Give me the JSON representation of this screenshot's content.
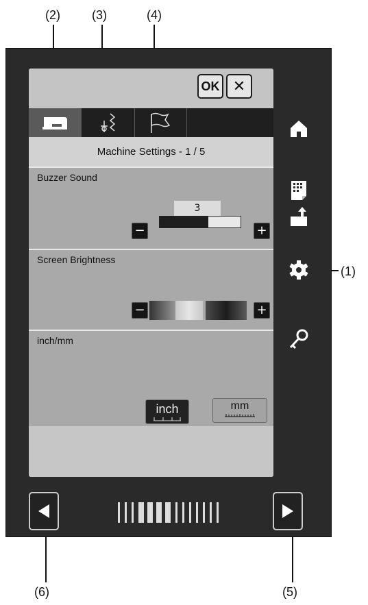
{
  "callouts": {
    "c1": "(1)",
    "c2": "(2)",
    "c3": "(3)",
    "c4": "(4)",
    "c5": "(5)",
    "c6": "(6)"
  },
  "header": {
    "ok_label": "OK",
    "close_symbol": "✕"
  },
  "tabs": [
    {
      "icon": "sewing-machine-icon",
      "active": true
    },
    {
      "icon": "stitch-icon",
      "active": false
    },
    {
      "icon": "flag-icon",
      "active": false
    }
  ],
  "page_title": "Machine Settings  -  1 / 5",
  "settings": {
    "buzzer": {
      "label": "Buzzer Sound",
      "value": "3",
      "minus": "−",
      "plus": "+",
      "level_fraction": 0.6
    },
    "brightness": {
      "label": "Screen Brightness",
      "minus": "−",
      "plus": "+"
    },
    "units": {
      "label": "inch/mm",
      "inch": "inch",
      "mm": "mm",
      "selected": "inch"
    }
  },
  "sidebar": [
    {
      "icon": "home-icon"
    },
    {
      "icon": "pattern-icon"
    },
    {
      "icon": "export-icon"
    },
    {
      "icon": "gear-icon"
    },
    {
      "icon": "key-icon"
    }
  ],
  "nav": {
    "prev_icon": "left-arrow-icon",
    "next_icon": "right-arrow-icon",
    "page_indicator_total": 5,
    "page_indicator_current": 1
  }
}
